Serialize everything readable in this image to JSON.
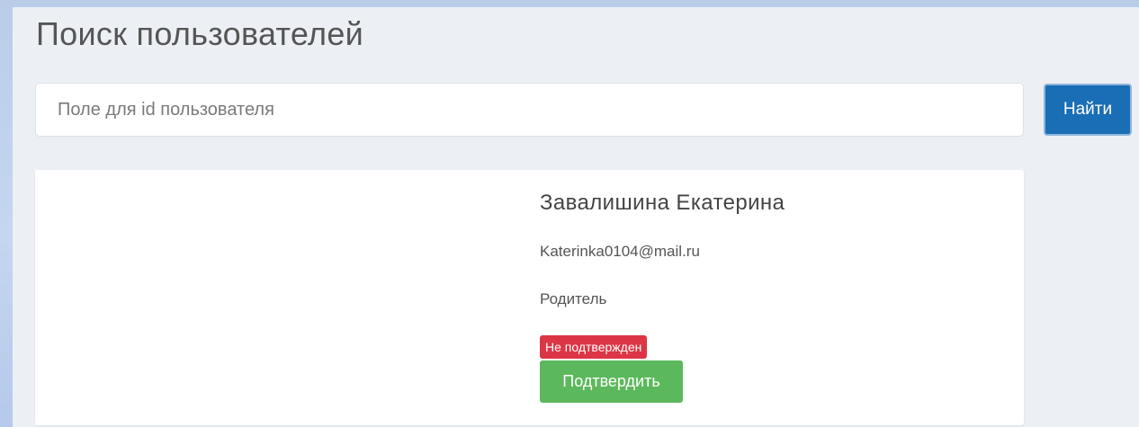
{
  "page": {
    "title": "Поиск пользователей"
  },
  "search": {
    "placeholder": "Поле для id пользователя",
    "value": "",
    "button_label": "Найти"
  },
  "user": {
    "name": "Завалишина Екатерина",
    "email": "Katerinka0104@mail.ru",
    "role": "Родитель",
    "status": "Не подтвержден",
    "confirm_label": "Подтвердить"
  },
  "colors": {
    "primary": "#1a6eb5",
    "success": "#5cb85c",
    "danger": "#dc3545",
    "page_background": "#ecf0f5"
  }
}
